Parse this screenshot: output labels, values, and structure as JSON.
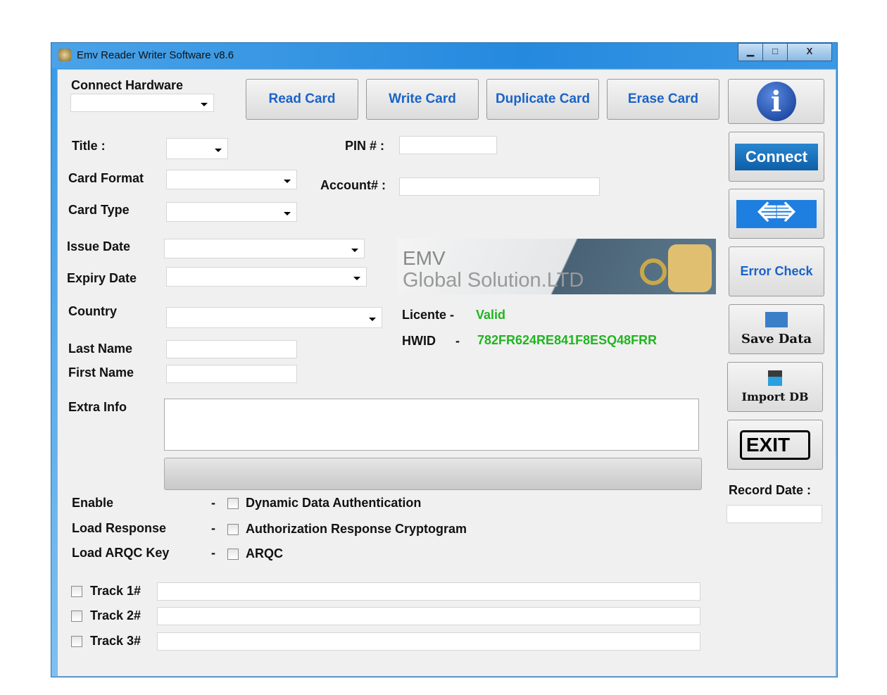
{
  "window": {
    "title": "Emv Reader Writer Software v8.6",
    "minimize": "▁",
    "maximize": "□",
    "close": "X"
  },
  "toolbar": {
    "connect_hardware_label": "Connect Hardware",
    "read_card": "Read Card",
    "write_card": "Write Card",
    "duplicate_card": "Duplicate Card",
    "erase_card": "Erase Card"
  },
  "side": {
    "connect": "Connect",
    "error_check": "Error Check",
    "save_data": "Save Data",
    "import_db": "Import DB",
    "exit": "EXIT",
    "record_date_label": "Record Date :"
  },
  "form": {
    "title": "Title :",
    "pin": "PIN # :",
    "card_format": "Card Format",
    "account": "Account# :",
    "card_type": "Card Type",
    "issue_date": "Issue Date",
    "expiry_date": "Expiry Date",
    "country": "Country",
    "last_name": "Last Name",
    "first_name": "First Name",
    "extra_info": "Extra Info"
  },
  "banner": {
    "line1": "EMV",
    "line2": "Global Solution.LTD"
  },
  "license": {
    "label": "Licente -",
    "value": "Valid",
    "hwid_label": "HWID",
    "hwid_dash": "-",
    "hwid_value": "782FR624RE841F8ESQ48FRR",
    "color": "#22b422"
  },
  "options": [
    {
      "label": "Enable",
      "dash": "-",
      "check": "Dynamic Data Authentication"
    },
    {
      "label": "Load Response",
      "dash": "-",
      "check": "Authorization Response Cryptogram"
    },
    {
      "label": "Load ARQC Key",
      "dash": "-",
      "check": "ARQC"
    }
  ],
  "tracks": [
    "Track 1#",
    "Track 2#",
    "Track 3#"
  ]
}
